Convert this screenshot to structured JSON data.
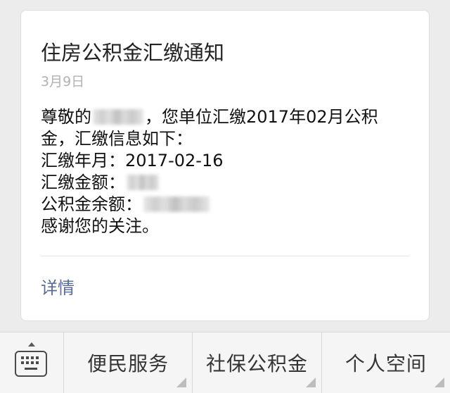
{
  "card": {
    "title": "住房公积金汇缴通知",
    "date": "3月9日",
    "greeting_prefix": "尊敬的",
    "greeting_suffix": "，您单位汇缴2017年02月公积",
    "line2": "金，汇缴信息如下：",
    "month_label": "汇缴年月：",
    "month_value": "2017-02-16",
    "amount_label": "汇缴金额：",
    "balance_label": "公积金余额：",
    "closing": "感谢您的关注。",
    "details_link": "详情"
  },
  "menu": {
    "keyboard_icon": "keyboard-icon",
    "items": [
      {
        "label": "便民服务"
      },
      {
        "label": "社保公积金"
      },
      {
        "label": "个人空间"
      }
    ]
  },
  "colors": {
    "background": "#ececec",
    "card": "#ffffff",
    "link": "#576b95",
    "date": "#b2b2b2",
    "menu_bar": "#f5f5f5"
  }
}
